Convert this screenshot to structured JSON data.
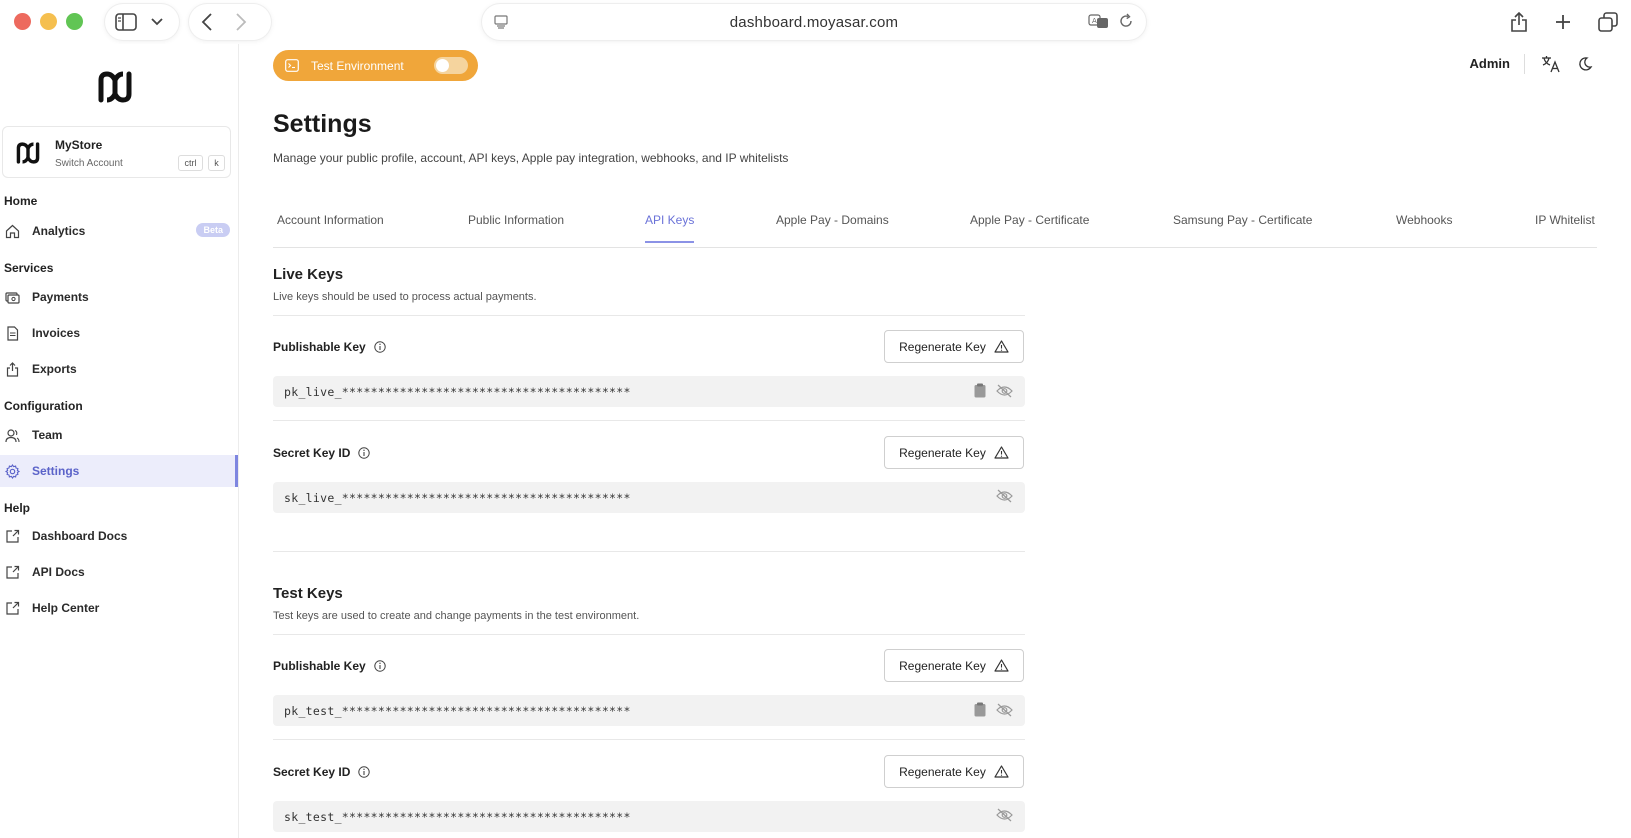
{
  "browser": {
    "url": "dashboard.moyasar.com"
  },
  "sidebar": {
    "account": {
      "name": "MyStore",
      "subtitle": "Switch Account",
      "shortcut_ctrl": "ctrl",
      "shortcut_k": "k"
    },
    "sections": {
      "home": "Home",
      "services": "Services",
      "configuration": "Configuration",
      "help": "Help"
    },
    "items": {
      "analytics": "Analytics",
      "analytics_badge": "Beta",
      "payments": "Payments",
      "invoices": "Invoices",
      "exports": "Exports",
      "team": "Team",
      "settings": "Settings",
      "dashboard_docs": "Dashboard Docs",
      "api_docs": "API Docs",
      "help_center": "Help Center"
    }
  },
  "topbar": {
    "test_env_label": "Test Environment",
    "test_env_on": false,
    "user": "Admin"
  },
  "page": {
    "title": "Settings",
    "subtitle": "Manage your public profile, account, API keys, Apple pay integration, webhooks, and IP whitelists"
  },
  "tabs": [
    {
      "label": "Account Information",
      "active": false
    },
    {
      "label": "Public Information",
      "active": false
    },
    {
      "label": "API Keys",
      "active": true
    },
    {
      "label": "Apple Pay - Domains",
      "active": false
    },
    {
      "label": "Apple Pay - Certificate",
      "active": false
    },
    {
      "label": "Samsung Pay - Certificate",
      "active": false
    },
    {
      "label": "Webhooks",
      "active": false
    },
    {
      "label": "IP Whitelist",
      "active": false
    }
  ],
  "live": {
    "title": "Live Keys",
    "description": "Live keys should be used to process actual payments.",
    "publishable_label": "Publishable Key",
    "publishable_value": "pk_live_****************************************",
    "secret_label": "Secret Key ID",
    "secret_value": "sk_live_****************************************",
    "regenerate_label": "Regenerate Key"
  },
  "test": {
    "title": "Test Keys",
    "description": "Test keys are used to create and change payments in the test environment.",
    "publishable_label": "Publishable Key",
    "publishable_value": "pk_test_****************************************",
    "secret_label": "Secret Key ID",
    "secret_value": "sk_test_****************************************",
    "regenerate_label": "Regenerate Key"
  },
  "colors": {
    "accent": "#6a72d8",
    "test_env": "#f0a63a",
    "active_bg": "#ecedfb"
  }
}
